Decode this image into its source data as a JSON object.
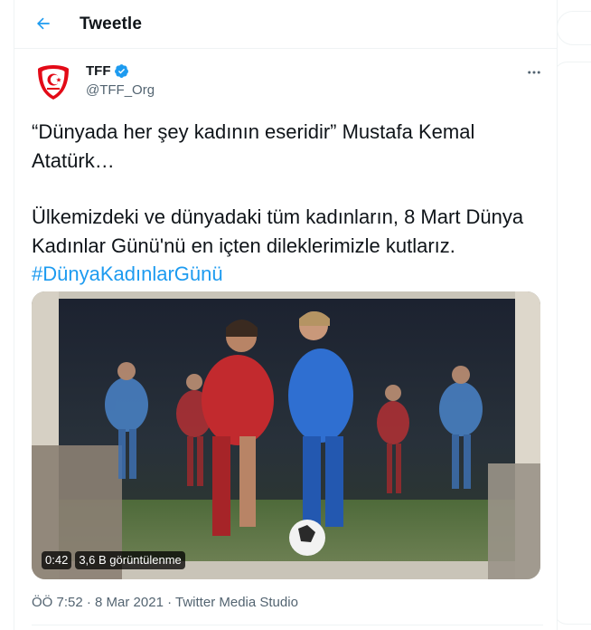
{
  "header": {
    "title": "Tweetle",
    "back_icon": "arrow-left-icon"
  },
  "colors": {
    "accent": "#1d9bf0",
    "text": "#0f1419",
    "muted": "#536471",
    "verified": "#1d9bf0",
    "logo_red": "#e30a17"
  },
  "author": {
    "name": "TFF",
    "handle": "@TFF_Org",
    "verified_icon": "verified-badge-icon",
    "avatar_icon": "tff-crest-logo"
  },
  "tweet": {
    "line1": "“Dünyada her şey kadının eseridir” Mustafa Kemal Atatürk…",
    "line2": "Ülkemizdeki ve dünyadaki tüm kadınların, 8 Mart Dünya Kadınlar Günü'nü en içten dileklerimizle kutlarız.",
    "hashtag": "#DünyaKadınlarGünü"
  },
  "media": {
    "duration": "0:42",
    "views": "3,6 B görüntülenme"
  },
  "meta": {
    "time": "ÖÖ 7:52",
    "separator1": "·",
    "date": "8 Mar 2021",
    "separator2": "·",
    "source": "Twitter Media Studio"
  }
}
